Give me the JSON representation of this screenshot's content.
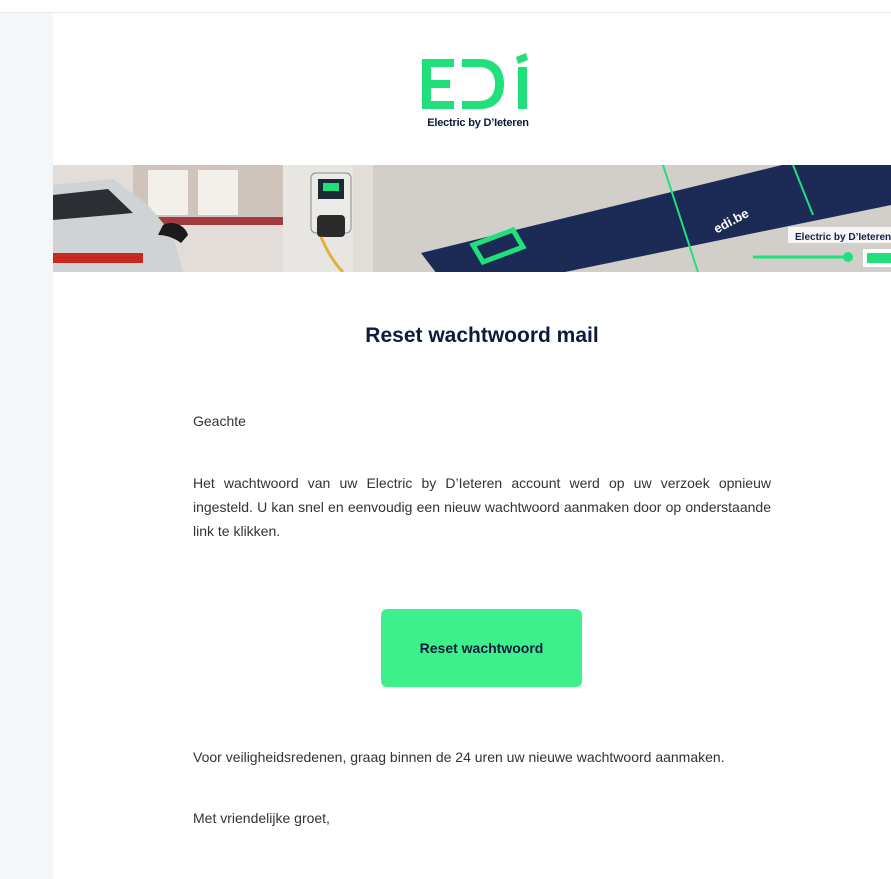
{
  "logo": {
    "mark_icon": "edi-logo-icon",
    "subtitle": "Electric by D’Ieteren",
    "brand_color": "#21e07c"
  },
  "banner": {
    "url_text": "edi.be",
    "brand_text": "Electric by D’Ieteren",
    "card_icon": "edi-card-icon"
  },
  "email": {
    "title": "Reset wachtwoord mail",
    "greeting": "Geachte",
    "paragraph1": "Het wachtwoord van uw Electric by D’Ieteren account werd op uw verzoek opnieuw ingesteld. U kan snel en eenvoudig een nieuw wachtwoord aanmaken door op onderstaande link te klikken.",
    "button_label": "Reset wachtwoord",
    "paragraph2": "Voor veiligheidsredenen, graag binnen de 24 uren uw nieuwe wachtwoord aanmaken.",
    "closing": "Met vriendelijke groet,"
  },
  "colors": {
    "accent": "#3ef08b",
    "title": "#0d1b3e",
    "text": "#333333"
  }
}
